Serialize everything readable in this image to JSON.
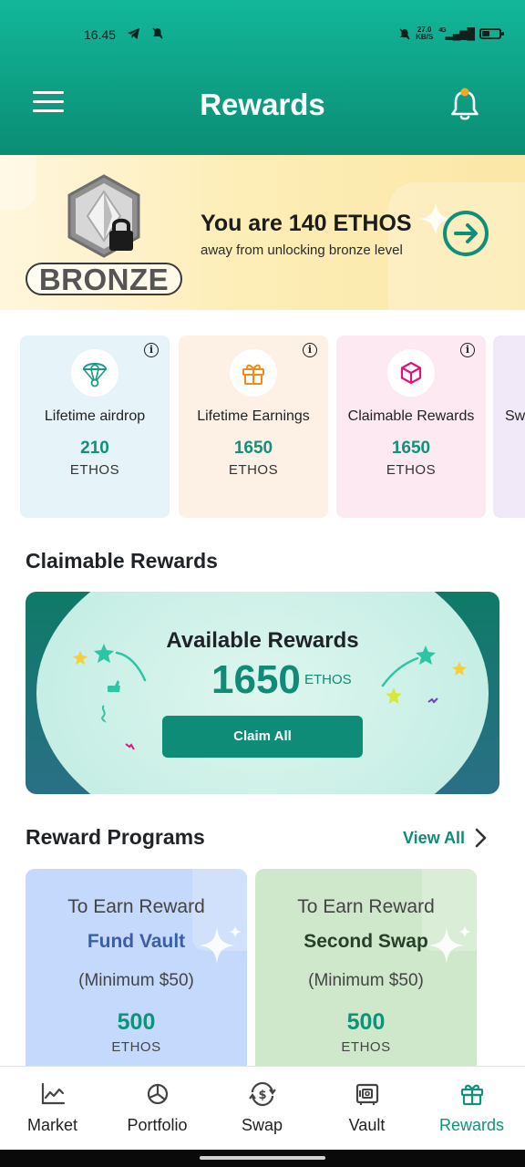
{
  "status_bar": {
    "time": "16.45",
    "left_icons": [
      "telegram-icon",
      "mute-icon"
    ],
    "net_speed_value": "27.0",
    "net_speed_unit": "KB/S",
    "network": "4G",
    "battery_level": 0.4
  },
  "header": {
    "title": "Rewards",
    "menu_icon": "hamburger-icon",
    "bell_icon": "bell-icon",
    "bell_dot_color": "#f5a623"
  },
  "banner": {
    "level_label": "BRONZE",
    "heading": "You are 140 ETHOS",
    "subtext": "away from unlocking bronze level",
    "arrow_icon": "arrow-right-circle-icon"
  },
  "stats": [
    {
      "label": "Lifetime airdrop",
      "value": "210",
      "unit": "ETHOS",
      "icon": "parachute-icon",
      "bg": "#e6f3f8",
      "icon_color": "#1a9a86"
    },
    {
      "label": "Lifetime Earnings",
      "value": "1650",
      "unit": "ETHOS",
      "icon": "gift-icon",
      "bg": "#fdf1e6",
      "icon_color": "#f08a1a"
    },
    {
      "label": "Claimable Rewards",
      "value": "1650",
      "unit": "ETHOS",
      "icon": "box-icon",
      "bg": "#fce9f1",
      "icon_color": "#e0147a"
    },
    {
      "label": "Sw",
      "value": "",
      "unit": "",
      "icon": "",
      "bg": "#f1e8f8",
      "icon_color": "#7a3fc9"
    }
  ],
  "claimable": {
    "section_title": "Claimable Rewards",
    "card_title": "Available Rewards",
    "amount": "1650",
    "unit": "ETHOS",
    "button_label": "Claim All"
  },
  "programs": {
    "section_title": "Reward Programs",
    "view_all_label": "View All",
    "items": [
      {
        "line1": "To Earn Reward",
        "action": "Fund Vault",
        "minimum": "(Minimum $50)",
        "value": "500",
        "unit": "ETHOS",
        "bg": "#c4d9fb",
        "action_color": "#3a5fa8"
      },
      {
        "line1": "To Earn Reward",
        "action": "Second Swap",
        "minimum": "(Minimum $50)",
        "value": "500",
        "unit": "ETHOS",
        "bg": "#cfe8cc",
        "action_color": "#26402a"
      }
    ]
  },
  "nav": {
    "items": [
      {
        "label": "Market",
        "icon": "chart-line-icon"
      },
      {
        "label": "Portfolio",
        "icon": "pie-chart-icon"
      },
      {
        "label": "Swap",
        "icon": "swap-dollar-icon"
      },
      {
        "label": "Vault",
        "icon": "vault-icon"
      },
      {
        "label": "Rewards",
        "icon": "gift-icon"
      }
    ],
    "active": "Rewards",
    "active_color": "#12917a"
  }
}
